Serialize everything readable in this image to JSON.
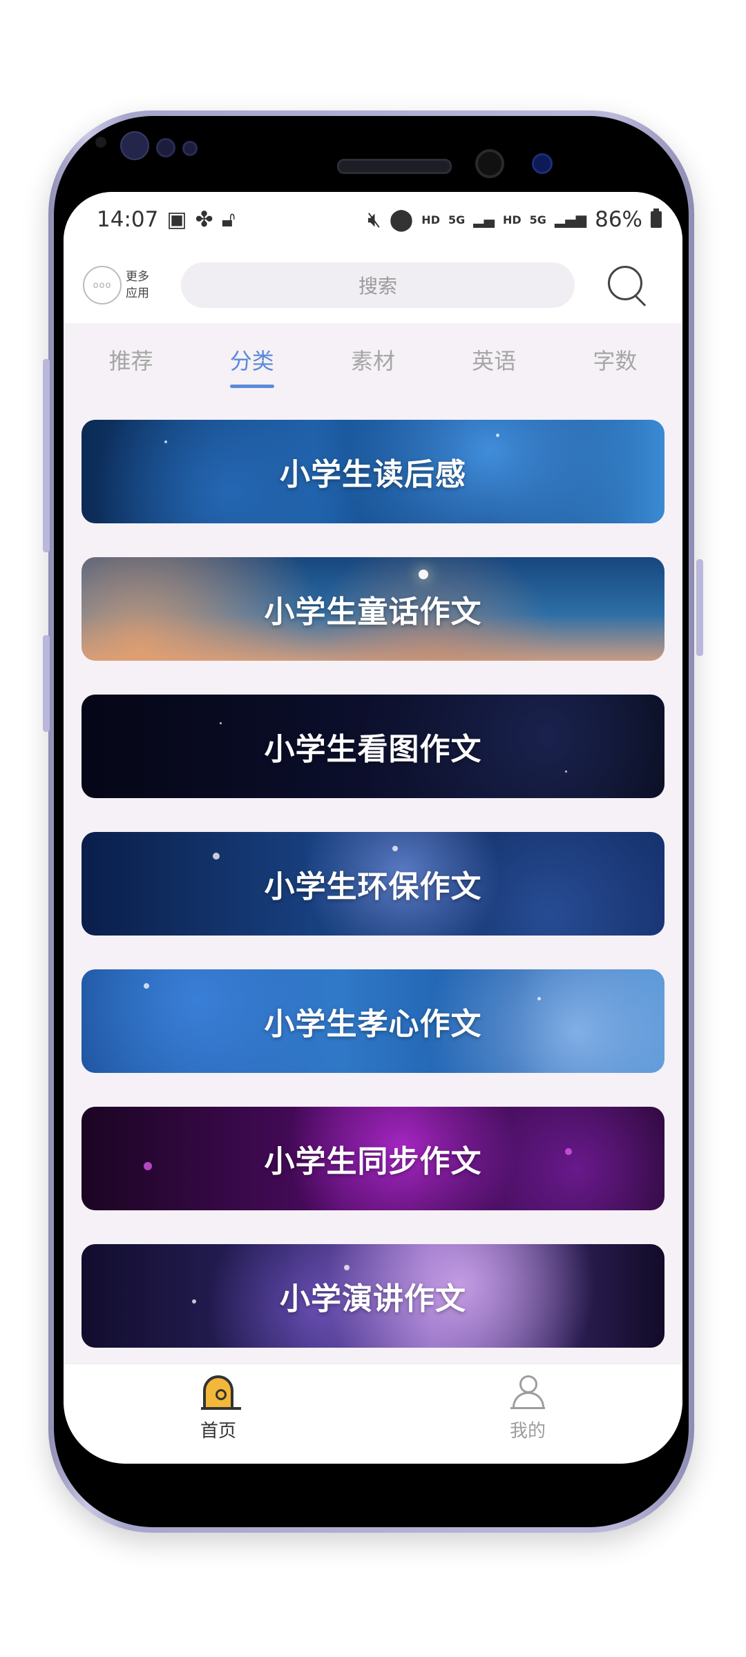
{
  "status_bar": {
    "time": "14:07",
    "hd1": "HD",
    "net1": "5G",
    "hd2": "HD",
    "net2": "5G",
    "battery": "86%"
  },
  "header": {
    "more_apps_line1": "更多",
    "more_apps_line2": "应用",
    "more_circle": "ooo",
    "search_placeholder": "搜索"
  },
  "tabs": [
    {
      "label": "推荐",
      "active": false
    },
    {
      "label": "分类",
      "active": true
    },
    {
      "label": "素材",
      "active": false
    },
    {
      "label": "英语",
      "active": false
    },
    {
      "label": "字数",
      "active": false
    }
  ],
  "categories": [
    {
      "label": "小学生读后感"
    },
    {
      "label": "小学生童话作文"
    },
    {
      "label": "小学生看图作文"
    },
    {
      "label": "小学生环保作文"
    },
    {
      "label": "小学生孝心作文"
    },
    {
      "label": "小学生同步作文"
    },
    {
      "label": "小学演讲作文"
    }
  ],
  "bottom_nav": [
    {
      "label": "首页",
      "icon": "home-icon",
      "active": true
    },
    {
      "label": "我的",
      "icon": "user-icon",
      "active": false
    }
  ],
  "colors": {
    "accent": "#5b8ad8",
    "frame": "#a7a5cb",
    "home_icon_fill": "#f3b73a"
  }
}
